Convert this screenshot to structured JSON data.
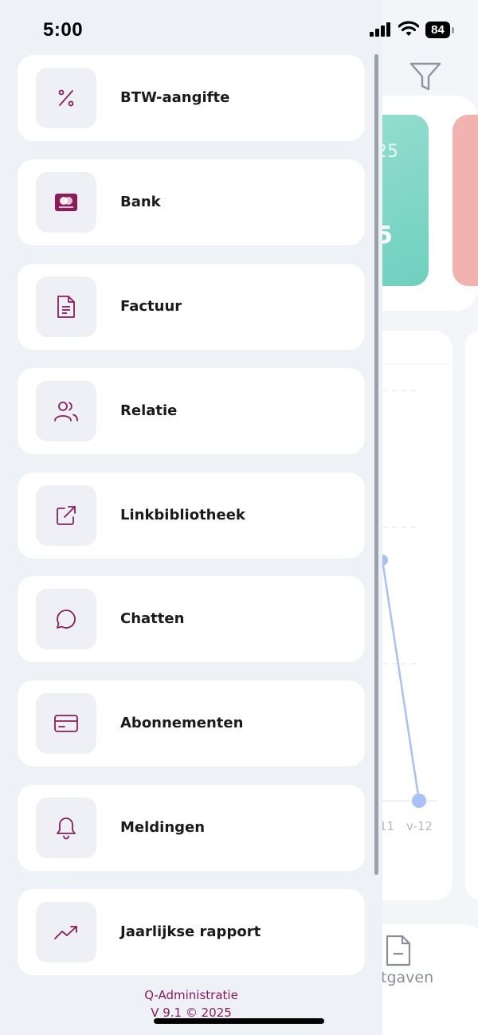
{
  "status_bar": {
    "time": "5:00",
    "battery": "84"
  },
  "background": {
    "kpi_green_top": "25",
    "kpi_green_value": "5",
    "x_labels": [
      "11",
      "v-12"
    ],
    "bottom_nav_label": "tgaven"
  },
  "menu": {
    "items": [
      {
        "label": "BTW-aangifte",
        "icon": "percent-icon"
      },
      {
        "label": "Bank",
        "icon": "bank-card-icon"
      },
      {
        "label": "Factuur",
        "icon": "document-icon"
      },
      {
        "label": "Relatie",
        "icon": "users-icon"
      },
      {
        "label": "Linkbibliotheek",
        "icon": "external-link-icon"
      },
      {
        "label": "Chatten",
        "icon": "chat-bubble-icon"
      },
      {
        "label": "Abonnementen",
        "icon": "credit-card-icon"
      },
      {
        "label": "Meldingen",
        "icon": "bell-icon"
      },
      {
        "label": "Jaarlijkse rapport",
        "icon": "trending-up-icon"
      }
    ]
  },
  "footer": {
    "app_name": "Q-Administratie",
    "version": "V 9.1 © 2025"
  },
  "colors": {
    "accent": "#8b1c5c",
    "kpi_green": "#7fd6c6",
    "kpi_red": "#f2b3b0",
    "chart_line": "#a9c1f5"
  }
}
